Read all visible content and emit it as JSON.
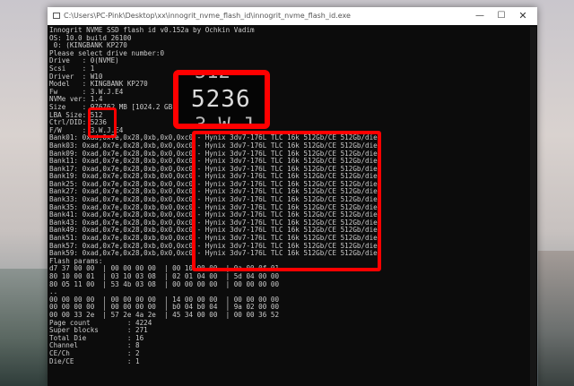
{
  "window": {
    "title": "C:\\Users\\PC-Pink\\Desktop\\xx\\innogrit_nvme_flash_id\\innogrit_nvme_flash_id.exe",
    "minimize": "—",
    "maximize": "☐",
    "close": "✕"
  },
  "console_lines": [
    "Innogrit NVME SSD flash id v0.152a by Ochkin Vadim",
    "OS: 10.0 build 26100",
    " 0: (KINGBANK KP270",
    "Please select drive number:0",
    "Drive   : 0(NVME)",
    "Scsi    : 1",
    "Driver  : W10",
    "Model   : KINGBANK KP270",
    "Fw      : 3.W.J.E4",
    "NVMe ver: 1.4",
    "Size    : 976762 MB [1024.2 GB]",
    "LBA Size: 512",
    "Ctrl/DID: 5236",
    "F/W     : 3.W.J.E4",
    "Bank01: 0xad,0x7e,0x28,0xb,0x0,0xc0 - Hynix 3dv7-176L TLC 16k 512Gb/CE 512Gb/die",
    "Bank03: 0xad,0x7e,0x28,0xb,0x0,0xc0 - Hynix 3dv7-176L TLC 16k 512Gb/CE 512Gb/die",
    "Bank09: 0xad,0x7e,0x28,0xb,0x0,0xc0 - Hynix 3dv7-176L TLC 16k 512Gb/CE 512Gb/die",
    "Bank11: 0xad,0x7e,0x28,0xb,0x0,0xc0 - Hynix 3dv7-176L TLC 16k 512Gb/CE 512Gb/die",
    "Bank17: 0xad,0x7e,0x28,0xb,0x0,0xc0 - Hynix 3dv7-176L TLC 16k 512Gb/CE 512Gb/die",
    "Bank19: 0xad,0x7e,0x28,0xb,0x0,0xc0 - Hynix 3dv7-176L TLC 16k 512Gb/CE 512Gb/die",
    "Bank25: 0xad,0x7e,0x28,0xb,0x0,0xc0 - Hynix 3dv7-176L TLC 16k 512Gb/CE 512Gb/die",
    "Bank27: 0xad,0x7e,0x28,0xb,0x0,0xc0 - Hynix 3dv7-176L TLC 16k 512Gb/CE 512Gb/die",
    "Bank33: 0xad,0x7e,0x28,0xb,0x0,0xc0 - Hynix 3dv7-176L TLC 16k 512Gb/CE 512Gb/die",
    "Bank35: 0xad,0x7e,0x28,0xb,0x0,0xc0 - Hynix 3dv7-176L TLC 16k 512Gb/CE 512Gb/die",
    "Bank41: 0xad,0x7e,0x28,0xb,0x0,0xc0 - Hynix 3dv7-176L TLC 16k 512Gb/CE 512Gb/die",
    "Bank43: 0xad,0x7e,0x28,0xb,0x0,0xc0 - Hynix 3dv7-176L TLC 16k 512Gb/CE 512Gb/die",
    "Bank49: 0xad,0x7e,0x28,0xb,0x0,0xc0 - Hynix 3dv7-176L TLC 16k 512Gb/CE 512Gb/die",
    "Bank51: 0xad,0x7e,0x28,0xb,0x0,0xc0 - Hynix 3dv7-176L TLC 16k 512Gb/CE 512Gb/die",
    "Bank57: 0xad,0x7e,0x28,0xb,0x0,0xc0 - Hynix 3dv7-176L TLC 16k 512Gb/CE 512Gb/die",
    "Bank59: 0xad,0x7e,0x28,0xb,0x0,0xc0 - Hynix 3dv7-176L TLC 16k 512Gb/CE 512Gb/die",
    "Flash params:",
    "d7 37 00 00  | 00 00 00 00  | 00 10 00 00  | 0a 00 0f 01",
    "80 10 00 01  | 03 10 03 08  | 02 01 04 00  | 5d 04 00 00",
    "80 05 11 00  | 53 4b 03 08  | 00 00 00 00  | 00 00 00 00",
    "..",
    "00 00 00 00  | 00 00 00 00  | 14 00 00 00  | 00 00 00 00",
    "00 00 00 00  | 00 00 00 00  | b0 04 b0 04  | 9a 02 00 00",
    "00 00 33 2e  | 57 2e 4a 2e  | 45 34 00 00  | 00 00 36 52",
    "Page count         : 4224",
    "Super blocks       : 271",
    "Total Die          : 16",
    "Channel            : 8",
    "CE/Ch              : 2",
    "Die/CE             : 1"
  ],
  "zoom": {
    "partial_top": "512",
    "value": "5236",
    "partial_bottom": "3.W.J"
  },
  "colors": {
    "highlight": "#ff0000",
    "console_bg": "#0c0c0c",
    "console_text": "#cccccc"
  }
}
